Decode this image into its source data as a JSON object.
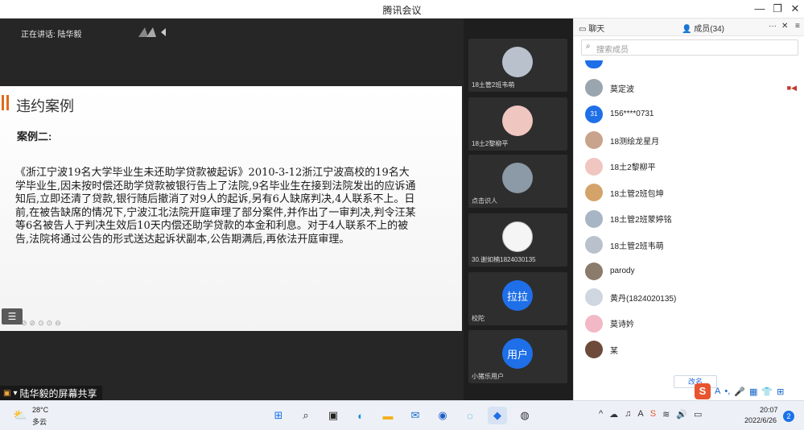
{
  "window": {
    "title": "腾讯会议",
    "minimize": "—",
    "restore": "❐",
    "close": "✕"
  },
  "main": {
    "speaking": "正在讲话: 陆华毅",
    "slide": {
      "title": "违约案例",
      "subtitle": "案例二:",
      "body": "《浙江宁波19名大学毕业生未还助学贷款被起诉》2010-3-12浙江宁波高校的19名大学毕业生,因未按时偿还助学贷款被银行告上了法院,9名毕业生在接到法院发出的应诉通知后,立即还清了贷款,银行随后撤消了对9人的起诉,另有6人缺席判决,4人联系不上。日前,在被告缺席的情况下,宁波江北法院开庭审理了部分案件,并作出了一审判决,判令汪某等6名被告人于判决生效后10天内偿还助学贷款的本金和利息。对于4人联系不上的被告,法院将通过公告的形式送达起诉状副本,公告期满后,再依法开庭审理。"
    },
    "annot_tools": "⊘⊘⊙⊙⊖",
    "menu_icon": "☰",
    "share_label": "陆华毅的屏幕共享"
  },
  "strip": {
    "tiles": [
      {
        "name": "18土管2班韦萌",
        "avatar_text": "",
        "color": "#b9c2cc"
      },
      {
        "name": "18土2黎柳平",
        "avatar_text": "",
        "color": "#f0c6c0"
      },
      {
        "name": "点击识人",
        "avatar_text": "",
        "color": "#8c99a6"
      },
      {
        "name": "30.谢如楠1824030135",
        "avatar_text": "",
        "color": "#f5f5f5"
      },
      {
        "name": "校陀",
        "avatar_text": "拉拉",
        "color": "#1e6fe8"
      },
      {
        "name": "小猪乐用户",
        "avatar_text": "用户",
        "color": "#1e6fe8"
      }
    ]
  },
  "panel": {
    "tab_chat": "聊天",
    "tab_members": "成员(34)",
    "more": "···",
    "close": "✕",
    "menu": "≡",
    "search_placeholder": "搜索成员",
    "members": [
      {
        "name": "莫定波",
        "avatar": "",
        "color": "#9aa5ad",
        "cam": "■◀"
      },
      {
        "name": "156****0731",
        "avatar": "31",
        "color": "#1e6fe8",
        "cam": ""
      },
      {
        "name": "18测绘龙星月",
        "avatar": "",
        "color": "#c9a38c",
        "cam": ""
      },
      {
        "name": "18土2黎柳平",
        "avatar": "",
        "color": "#f0c6c0",
        "cam": ""
      },
      {
        "name": "18土管2班包坤",
        "avatar": "",
        "color": "#d4a36a",
        "cam": ""
      },
      {
        "name": "18土管2班蒙婷铭",
        "avatar": "",
        "color": "#a7b5c4",
        "cam": ""
      },
      {
        "name": "18土管2班韦萌",
        "avatar": "",
        "color": "#b9c2cc",
        "cam": ""
      },
      {
        "name": "parody",
        "avatar": "",
        "color": "#8a7b6a",
        "cam": ""
      },
      {
        "name": "黄丹(1824020135)",
        "avatar": "",
        "color": "#d0d6e0",
        "cam": ""
      },
      {
        "name": "莫诗妗",
        "avatar": "",
        "color": "#f2b8c6",
        "cam": ""
      },
      {
        "name": "某",
        "avatar": "",
        "color": "#6e4a3a",
        "cam": ""
      }
    ],
    "rename": "改名",
    "ime": {
      "logo": "S",
      "a": "A",
      "dot": "•,",
      "mic": "🎤",
      "kbd": "▦",
      "shirt": "👕",
      "grid": "⊞"
    }
  },
  "taskbar": {
    "temp": "28°C",
    "condition": "多云",
    "time": "20:07",
    "date": "2022/6/26",
    "notifications": "2",
    "tray": [
      "^",
      "☁",
      "♫",
      "A",
      "S",
      "≋",
      "🔊",
      "▭"
    ]
  }
}
